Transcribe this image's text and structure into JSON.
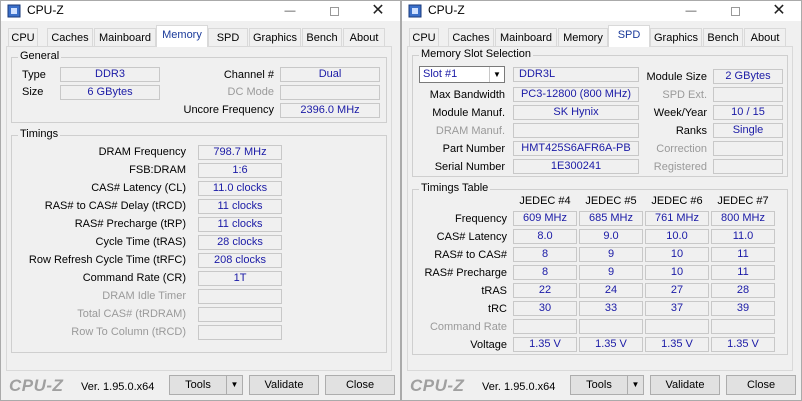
{
  "left": {
    "title": "CPU-Z",
    "tabs": [
      "CPU",
      "Caches",
      "Mainboard",
      "Memory",
      "SPD",
      "Graphics",
      "Bench",
      "About"
    ],
    "active_tab": "Memory",
    "general": {
      "title": "General",
      "type_label": "Type",
      "type_value": "DDR3",
      "size_label": "Size",
      "size_value": "6 GBytes",
      "channel_label": "Channel #",
      "channel_value": "Dual",
      "dc_mode_label": "DC Mode",
      "dc_mode_value": "",
      "uncore_label": "Uncore Frequency",
      "uncore_value": "2396.0 MHz"
    },
    "timings": {
      "title": "Timings",
      "rows": [
        {
          "label": "DRAM Frequency",
          "value": "798.7 MHz",
          "dim": false
        },
        {
          "label": "FSB:DRAM",
          "value": "1:6",
          "dim": false
        },
        {
          "label": "CAS# Latency (CL)",
          "value": "11.0 clocks",
          "dim": false
        },
        {
          "label": "RAS# to CAS# Delay (tRCD)",
          "value": "11 clocks",
          "dim": false
        },
        {
          "label": "RAS# Precharge (tRP)",
          "value": "11 clocks",
          "dim": false
        },
        {
          "label": "Cycle Time (tRAS)",
          "value": "28 clocks",
          "dim": false
        },
        {
          "label": "Row Refresh Cycle Time (tRFC)",
          "value": "208 clocks",
          "dim": false
        },
        {
          "label": "Command Rate (CR)",
          "value": "1T",
          "dim": false
        },
        {
          "label": "DRAM Idle Timer",
          "value": "",
          "dim": true
        },
        {
          "label": "Total CAS# (tRDRAM)",
          "value": "",
          "dim": true
        },
        {
          "label": "Row To Column (tRCD)",
          "value": "",
          "dim": true
        }
      ]
    }
  },
  "right": {
    "title": "CPU-Z",
    "tabs": [
      "CPU",
      "Caches",
      "Mainboard",
      "Memory",
      "SPD",
      "Graphics",
      "Bench",
      "About"
    ],
    "active_tab": "SPD",
    "slot": {
      "title": "Memory Slot Selection",
      "selected": "Slot #1",
      "type_value": "DDR3L",
      "module_size_label": "Module Size",
      "module_size_value": "2 GBytes",
      "max_bw_label": "Max Bandwidth",
      "max_bw_value": "PC3-12800 (800 MHz)",
      "spd_ext_label": "SPD Ext.",
      "spd_ext_value": "",
      "manuf_label": "Module Manuf.",
      "manuf_value": "SK Hynix",
      "weekyear_label": "Week/Year",
      "weekyear_value": "10 / 15",
      "dram_manuf_label": "DRAM Manuf.",
      "dram_manuf_value": "",
      "ranks_label": "Ranks",
      "ranks_value": "Single",
      "part_label": "Part Number",
      "part_value": "HMT425S6AFR6A-PB",
      "correction_label": "Correction",
      "correction_value": "",
      "serial_label": "Serial Number",
      "serial_value": "1E300241",
      "registered_label": "Registered",
      "registered_value": ""
    },
    "timings_table": {
      "title": "Timings Table",
      "columns": [
        "JEDEC #4",
        "JEDEC #5",
        "JEDEC #6",
        "JEDEC #7"
      ],
      "rows": [
        {
          "label": "Frequency",
          "values": [
            "609 MHz",
            "685 MHz",
            "761 MHz",
            "800 MHz"
          ],
          "dim": false
        },
        {
          "label": "CAS# Latency",
          "values": [
            "8.0",
            "9.0",
            "10.0",
            "11.0"
          ],
          "dim": false
        },
        {
          "label": "RAS# to CAS#",
          "values": [
            "8",
            "9",
            "10",
            "11"
          ],
          "dim": false
        },
        {
          "label": "RAS# Precharge",
          "values": [
            "8",
            "9",
            "10",
            "11"
          ],
          "dim": false
        },
        {
          "label": "tRAS",
          "values": [
            "22",
            "24",
            "27",
            "28"
          ],
          "dim": false
        },
        {
          "label": "tRC",
          "values": [
            "30",
            "33",
            "37",
            "39"
          ],
          "dim": false
        },
        {
          "label": "Command Rate",
          "values": [
            "",
            "",
            "",
            ""
          ],
          "dim": true
        },
        {
          "label": "Voltage",
          "values": [
            "1.35 V",
            "1.35 V",
            "1.35 V",
            "1.35 V"
          ],
          "dim": false
        }
      ]
    }
  },
  "footer": {
    "logo": "CPU-Z",
    "version": "Ver. 1.95.0.x64",
    "tools_label": "Tools",
    "validate_label": "Validate",
    "close_label": "Close"
  },
  "colors": {
    "value_text": "#1a1aa6",
    "active_tab_text": "#1a3a9a",
    "dim_text": "#9a9a9a"
  }
}
